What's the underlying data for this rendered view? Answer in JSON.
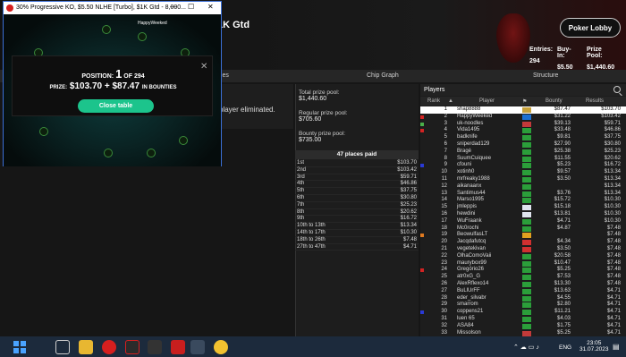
{
  "lobby": {
    "title": "1K Gtd",
    "poker_lobby_btn": "Poker Lobby",
    "stats": {
      "entries_label": "Entries:",
      "entries": "294",
      "buyin_label": "Buy-In:",
      "buyin": "$5.50",
      "prize_label": "Prize Pool:",
      "prize": "$1,440.60"
    },
    "tabs": [
      "bles",
      "Chip Graph",
      "Structure"
    ],
    "elim_text": "player eliminated."
  },
  "prizes": {
    "total_label": "Total prize pool:",
    "total": "$1,440.60",
    "regular_label": "Regular prize pool:",
    "regular": "$705.60",
    "bounty_label": "Bounty prize pool:",
    "bounty": "$735.00",
    "places_header": "47 places paid",
    "places": [
      {
        "p": "1st",
        "a": "$103.70"
      },
      {
        "p": "2nd",
        "a": "$103.42"
      },
      {
        "p": "3rd",
        "a": "$59.71"
      },
      {
        "p": "4th",
        "a": "$46.86"
      },
      {
        "p": "5th",
        "a": "$37.75"
      },
      {
        "p": "6th",
        "a": "$30.80"
      },
      {
        "p": "7th",
        "a": "$25.23"
      },
      {
        "p": "8th",
        "a": "$20.62"
      },
      {
        "p": "9th",
        "a": "$16.72"
      },
      {
        "p": "10th to 13th",
        "a": "$13.34"
      },
      {
        "p": "14th to 17th",
        "a": "$10.30"
      },
      {
        "p": "18th to 26th",
        "a": "$7.48"
      },
      {
        "p": "27th to 47th",
        "a": "$4.71"
      }
    ]
  },
  "players": {
    "header": "Players",
    "cols": {
      "rank": "Rank",
      "player": "Player",
      "bounty": "Bounty",
      "results": "Results"
    },
    "rows": [
      {
        "rk": "1",
        "nm": "shap8888",
        "fl": "#c7a13a",
        "bt": "$87.47",
        "rs": "$103.70",
        "mk": "",
        "me": true
      },
      {
        "rk": "2",
        "nm": "HappyWeeked",
        "fl": "#1c6fd1",
        "bt": "$31.22",
        "rs": "$103.42",
        "mk": "#d32323"
      },
      {
        "rk": "3",
        "nm": "uk-noodles",
        "fl": "#c23a3a",
        "bt": "$39.13",
        "rs": "$59.71",
        "mk": "#4ab04a"
      },
      {
        "rk": "4",
        "nm": "Vida1495",
        "fl": "#2b9e3a",
        "bt": "$33.48",
        "rs": "$46.86",
        "mk": "#d32323"
      },
      {
        "rk": "5",
        "nm": "badknife",
        "fl": "#2b9e3a",
        "bt": "$9.81",
        "rs": "$37.75",
        "mk": ""
      },
      {
        "rk": "6",
        "nm": "sniperdad129",
        "fl": "#2b9e3a",
        "bt": "$27.90",
        "rs": "$30.80",
        "mk": ""
      },
      {
        "rk": "7",
        "nm": "Bragé",
        "fl": "#2b9e3a",
        "bt": "$25.38",
        "rs": "$25.23",
        "mk": ""
      },
      {
        "rk": "8",
        "nm": "SuumCuiquee",
        "fl": "#2b9e3a",
        "bt": "$11.55",
        "rs": "$20.62",
        "mk": ""
      },
      {
        "rk": "9",
        "nm": "cfouni",
        "fl": "#2b9e3a",
        "bt": "$5.23",
        "rs": "$16.72",
        "mk": "#2a3ad6"
      },
      {
        "rk": "10",
        "nm": "xotinh0",
        "fl": "#2b9e3a",
        "bt": "$9.57",
        "rs": "$13.34",
        "mk": ""
      },
      {
        "rk": "11",
        "nm": "mrfreaky1988",
        "fl": "#2b9e3a",
        "bt": "$3.50",
        "rs": "$13.34",
        "mk": ""
      },
      {
        "rk": "12",
        "nm": "aikanaanx",
        "fl": "#2b9e3a",
        "bt": "",
        "rs": "$13.34",
        "mk": ""
      },
      {
        "rk": "13",
        "nm": "Santimus44",
        "fl": "#2b9e3a",
        "bt": "$3.76",
        "rs": "$13.34",
        "mk": ""
      },
      {
        "rk": "14",
        "nm": "Marso1995",
        "fl": "#2b9e3a",
        "bt": "$15.72",
        "rs": "$10.30",
        "mk": ""
      },
      {
        "rk": "15",
        "nm": "jmleppis",
        "fl": "#dfe4ee",
        "bt": "$15.18",
        "rs": "$10.30",
        "mk": ""
      },
      {
        "rk": "16",
        "nm": "hewdini",
        "fl": "#dfe4ee",
        "bt": "$13.81",
        "rs": "$10.30",
        "mk": ""
      },
      {
        "rk": "17",
        "nm": "WuFraank",
        "fl": "#2b9e3a",
        "bt": "$4.71",
        "rs": "$10.30",
        "mk": ""
      },
      {
        "rk": "18",
        "nm": "Mc0rochi",
        "fl": "#2b9e3a",
        "bt": "$4.87",
        "rs": "$7.48",
        "mk": ""
      },
      {
        "rk": "19",
        "nm": "BeowulfasLT",
        "fl": "#e0a020",
        "bt": "",
        "rs": "$7.48",
        "mk": "#e07a20"
      },
      {
        "rk": "20",
        "nm": "Jacqdafutcq",
        "fl": "#d03030",
        "bt": "$4.34",
        "rs": "$7.48",
        "mk": ""
      },
      {
        "rk": "21",
        "nm": "vegetekivan",
        "fl": "#d03030",
        "bt": "$3.50",
        "rs": "$7.48",
        "mk": ""
      },
      {
        "rk": "22",
        "nm": "OlhaComoVaii",
        "fl": "#2b9e3a",
        "bt": "$20.58",
        "rs": "$7.48",
        "mk": ""
      },
      {
        "rk": "23",
        "nm": "maurybox99",
        "fl": "#2b9e3a",
        "bt": "$10.47",
        "rs": "$7.48",
        "mk": ""
      },
      {
        "rk": "24",
        "nm": "Gregório26",
        "fl": "#2b9e3a",
        "bt": "$5.25",
        "rs": "$7.48",
        "mk": "#d32323"
      },
      {
        "rk": "25",
        "nm": "atr0xG_G",
        "fl": "#2b9e3a",
        "bt": "$7.53",
        "rs": "$7.48",
        "mk": ""
      },
      {
        "rk": "26",
        "nm": "AlexRflexo14",
        "fl": "#2b9e3a",
        "bt": "$13.30",
        "rs": "$7.48",
        "mk": ""
      },
      {
        "rk": "27",
        "nm": "BuLlUrFF",
        "fl": "#2b9e3a",
        "bt": "$13.63",
        "rs": "$4.71",
        "mk": ""
      },
      {
        "rk": "28",
        "nm": "eder_silvabr",
        "fl": "#2b9e3a",
        "bt": "$4.55",
        "rs": "$4.71",
        "mk": ""
      },
      {
        "rk": "29",
        "nm": "smarrom",
        "fl": "#2b9e3a",
        "bt": "$2.80",
        "rs": "$4.71",
        "mk": ""
      },
      {
        "rk": "30",
        "nm": "coppens21",
        "fl": "#2b9e3a",
        "bt": "$11.21",
        "rs": "$4.71",
        "mk": "#2a3ad6"
      },
      {
        "rk": "31",
        "nm": "luen 65",
        "fl": "#2b9e3a",
        "bt": "$4.03",
        "rs": "$4.71",
        "mk": ""
      },
      {
        "rk": "32",
        "nm": "ASA84",
        "fl": "#2b9e3a",
        "bt": "$1.75",
        "rs": "$4.71",
        "mk": ""
      },
      {
        "rk": "33",
        "nm": "Missolson",
        "fl": "#c23a3a",
        "bt": "$5.25",
        "rs": "$4.71",
        "mk": ""
      }
    ]
  },
  "popup": {
    "title": "30% Progressive KO, $5.50 NLHE [Turbo], $1K Gtd - 8,000...",
    "pos_prefix": "POSITION:",
    "pos_big": "1",
    "pos_suffix": "OF 294",
    "prize_prefix": "PRIZE:",
    "prize_amount": "$103.70 + $87.47",
    "prize_suffix": "IN BOUNTIES",
    "close_label": "Close table",
    "table_tag": "HappyWeeked"
  },
  "taskbar": {
    "time": "23:05",
    "date": "31.07.2023",
    "lang": "ENG"
  }
}
